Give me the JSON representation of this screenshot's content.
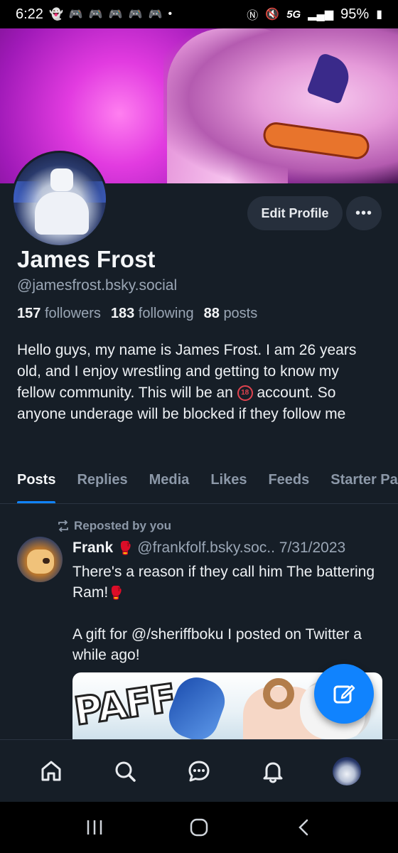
{
  "status_bar": {
    "time": "6:22",
    "network": "5G",
    "battery": "95%"
  },
  "profile": {
    "display_name": "James Frost",
    "handle": "@jamesfrost.bsky.social",
    "followers_count": "157",
    "followers_label": "followers",
    "following_count": "183",
    "following_label": "following",
    "posts_count": "88",
    "posts_label": "posts",
    "bio_part1": "Hello guys, my name is James Frost. I am 26 years old, and I enjoy wrestling and getting to know my fellow community. This will be an ",
    "bio_badge": "18",
    "bio_part2": " account. So anyone underage will be blocked if they follow me"
  },
  "actions": {
    "edit_profile_label": "Edit Profile",
    "more_label": "•••"
  },
  "tabs": [
    {
      "label": "Posts",
      "active": true
    },
    {
      "label": "Replies",
      "active": false
    },
    {
      "label": "Media",
      "active": false
    },
    {
      "label": "Likes",
      "active": false
    },
    {
      "label": "Feeds",
      "active": false
    },
    {
      "label": "Starter Packs",
      "active": false
    }
  ],
  "post": {
    "repost_label": "Reposted by you",
    "author_name": "Frank",
    "author_emoji": "🥊",
    "author_handle": "@frankfolf.bsky.soc..",
    "date": "7/31/2023",
    "text_line1": "There's a reason if they call him The battering Ram!",
    "text_emoji": "🥊",
    "text_line2": "A gift for @/sheriffboku I posted on Twitter a while ago!",
    "image_text": "PAFF"
  },
  "icons": {
    "repost": "repost-icon",
    "compose": "compose-icon",
    "home": "home-icon",
    "search": "search-icon",
    "chat": "chat-icon",
    "notifications": "bell-icon"
  },
  "colors": {
    "accent": "#1083fe",
    "background": "#161e27",
    "muted": "#9aa6b5"
  }
}
